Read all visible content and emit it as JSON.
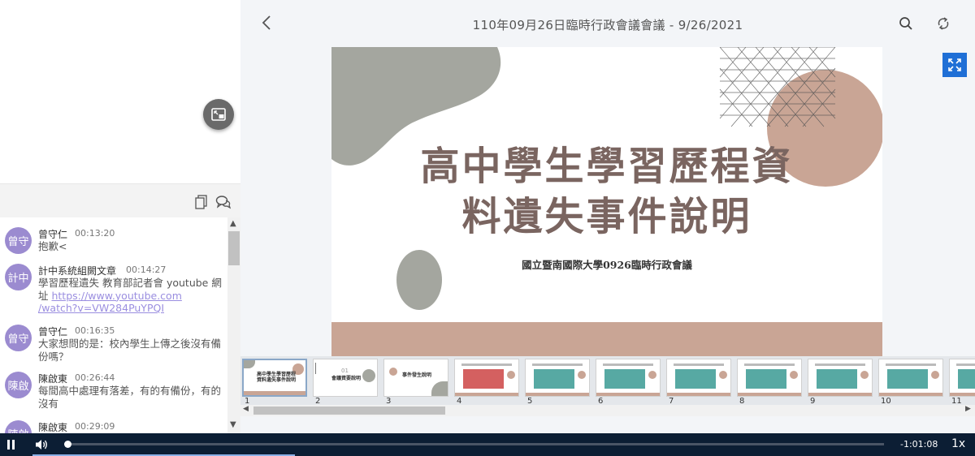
{
  "meeting": {
    "title": "110年09月26日臨時行政會議會議 - 9/26/2021"
  },
  "chat": {
    "messages": [
      {
        "avatar": "曾守",
        "name": "曾守仁",
        "time": "00:13:20",
        "text": "抱歉<"
      },
      {
        "avatar": "計中",
        "name": "計中系統組闕文章",
        "time": "00:14:27",
        "text": "學習歷程遺失 教育部記者會 youtube 網址 ",
        "link": "https://www.youtube.com/watch?v=VW284PuYPQI",
        "link_line1": "https://www.youtube.com",
        "link_line2": "/watch?v=VW284PuYPQI"
      },
      {
        "avatar": "曾守",
        "name": "曾守仁",
        "time": "00:16:35",
        "text": "大家想問的是：校內學生上傳之後沒有備份嗎？"
      },
      {
        "avatar": "陳啟",
        "name": "陳啟東",
        "time": "00:26:44",
        "text": "每間高中處理有落差，有的有備份，有的沒有"
      },
      {
        "avatar": "陳啟",
        "name": "陳啟東",
        "time": "00:29:09",
        "text": ""
      }
    ]
  },
  "slide": {
    "title_line1": "高中學生學習歷程資",
    "title_line2": "料遺失事件說明",
    "subtitle": "國立暨南國際大學0926臨時行政會議"
  },
  "thumbnails": [
    {
      "num": "1",
      "label": "高中學生學習歷程資料遺失事件說明"
    },
    {
      "num": "2",
      "label": "會議資要說明"
    },
    {
      "num": "3",
      "label": "事件發生說明"
    },
    {
      "num": "4",
      "label": ""
    },
    {
      "num": "5",
      "label": ""
    },
    {
      "num": "6",
      "label": ""
    },
    {
      "num": "7",
      "label": ""
    },
    {
      "num": "8",
      "label": ""
    },
    {
      "num": "9",
      "label": ""
    },
    {
      "num": "10",
      "label": ""
    },
    {
      "num": "11",
      "label": ""
    }
  ],
  "player": {
    "remaining": "-1:01:08",
    "speed": "1x",
    "progress": 0.003
  },
  "colors": {
    "accent": "#1f6fd6",
    "avatar": "#9b8bd0",
    "player_bg": "#0c1e34",
    "slide_text": "#7a6560"
  },
  "icons": {
    "pip": "picture-in-picture-icon",
    "copy": "copy-icon",
    "chat": "chat-bubbles-icon",
    "back": "chevron-left-icon",
    "search": "search-icon",
    "rotate": "rotate-icon",
    "fullscreen": "fullscreen-icon",
    "play": "pause-icon",
    "volume": "volume-icon"
  }
}
